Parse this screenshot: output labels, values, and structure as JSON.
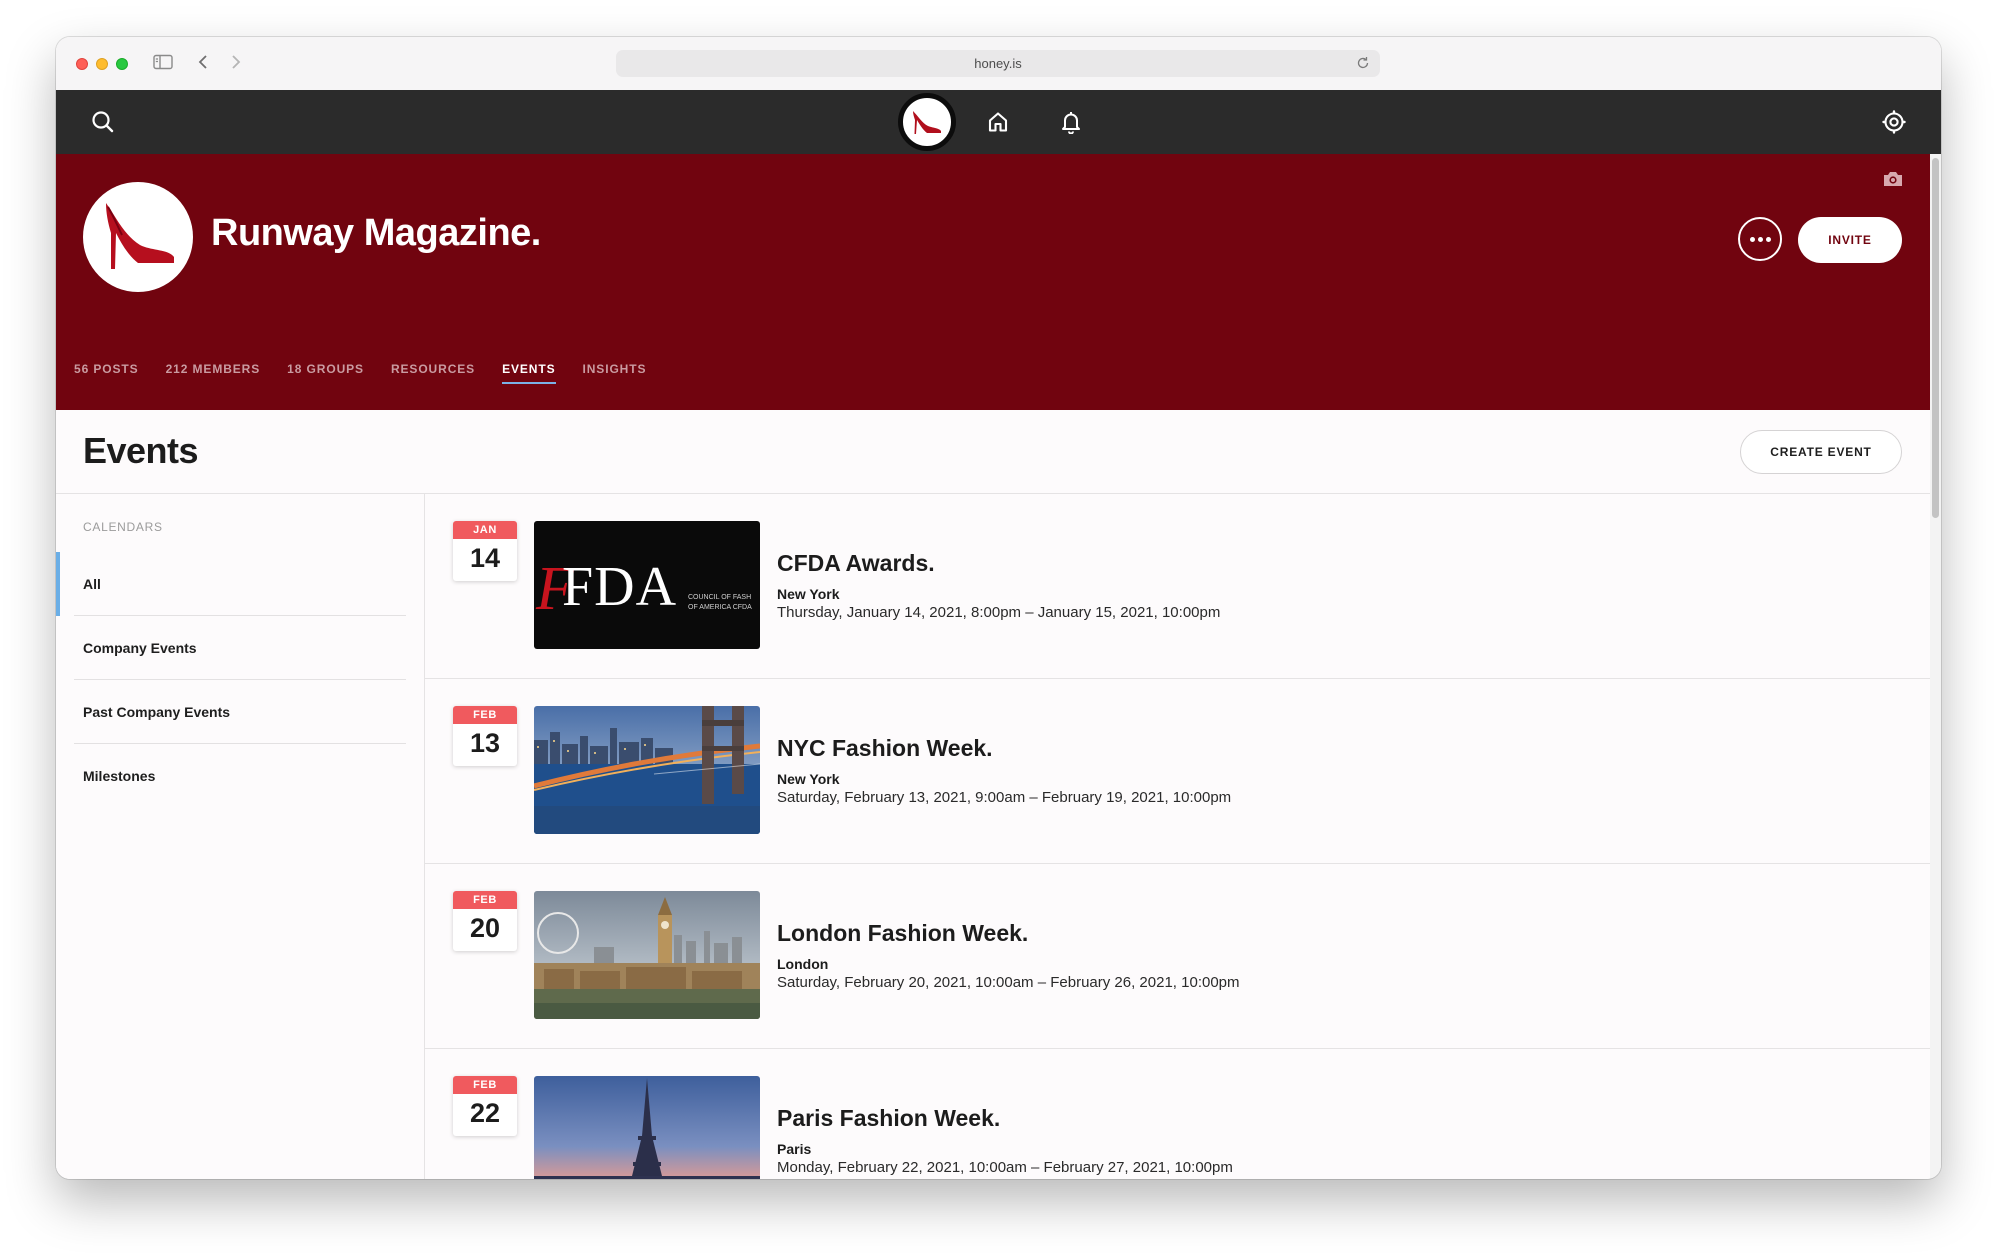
{
  "browser": {
    "url": "honey.is"
  },
  "app": {
    "group_title": "Runway Magazine.",
    "invite_label": "INVITE",
    "tabs": [
      {
        "label": "56 POSTS",
        "active": false
      },
      {
        "label": "212 MEMBERS",
        "active": false
      },
      {
        "label": "18 GROUPS",
        "active": false
      },
      {
        "label": "RESOURCES",
        "active": false
      },
      {
        "label": "EVENTS",
        "active": true
      },
      {
        "label": "INSIGHTS",
        "active": false
      }
    ]
  },
  "events_page": {
    "title": "Events",
    "create_label": "CREATE EVENT",
    "calendars_heading": "CALENDARS",
    "calendars": [
      {
        "label": "All",
        "active": true
      },
      {
        "label": "Company Events",
        "active": false
      },
      {
        "label": "Past Company Events",
        "active": false
      },
      {
        "label": "Milestones",
        "active": false
      }
    ],
    "events": [
      {
        "month": "JAN",
        "day": "14",
        "name": "CFDA Awards.",
        "location": "New York",
        "time": "Thursday, January 14, 2021, 8:00pm – January 15, 2021, 10:00pm",
        "thumb_logo": "FDA",
        "thumb_caption_1": "COUNCIL OF FASH",
        "thumb_caption_2": "OF AMERICA CFDA"
      },
      {
        "month": "FEB",
        "day": "13",
        "name": "NYC Fashion Week.",
        "location": "New York",
        "time": "Saturday, February 13, 2021, 9:00am – February 19, 2021, 10:00pm"
      },
      {
        "month": "FEB",
        "day": "20",
        "name": "London Fashion Week.",
        "location": "London",
        "time": "Saturday, February 20, 2021, 10:00am – February 26, 2021, 10:00pm"
      },
      {
        "month": "FEB",
        "day": "22",
        "name": "Paris Fashion Week.",
        "location": "Paris",
        "time": "Monday, February 22, 2021, 10:00am – February 27, 2021, 10:00pm"
      }
    ]
  },
  "colors": {
    "brand_maroon": "#71040f",
    "nav_dark": "#2b2b2b",
    "badge_red": "#f05a5e",
    "active_blue": "#6aaee6"
  },
  "icons": [
    "search-icon",
    "shoe-logo-icon",
    "home-icon",
    "bell-icon",
    "settings-icon",
    "camera-icon",
    "more-icon",
    "sidebar-icon",
    "back-icon",
    "forward-icon",
    "reload-icon"
  ]
}
